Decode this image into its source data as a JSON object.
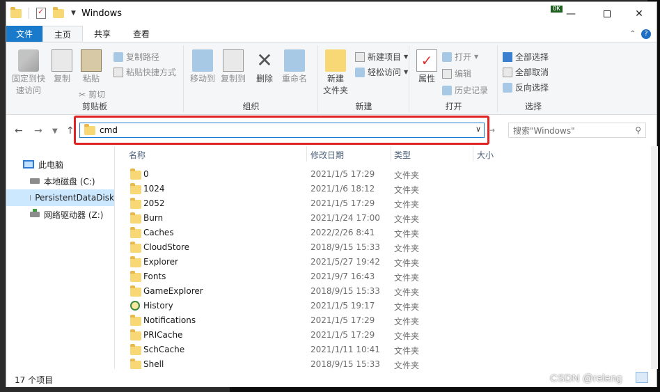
{
  "window": {
    "title": "Windows",
    "ok_badge": "OK"
  },
  "tabs": [
    {
      "label": "文件"
    },
    {
      "label": "主页"
    },
    {
      "label": "共享"
    },
    {
      "label": "查看"
    }
  ],
  "ribbon": {
    "clipboard": {
      "label": "剪贴板",
      "pin": "固定到快\n速访问",
      "copy": "复制",
      "paste": "粘贴",
      "copy_path": "复制路径",
      "paste_shortcut": "粘贴快捷方式",
      "cut": "剪切"
    },
    "organize": {
      "label": "组织",
      "move_to": "移动到",
      "copy_to": "复制到",
      "delete": "删除",
      "rename": "重命名"
    },
    "new": {
      "label": "新建",
      "new_folder": "新建\n文件夹",
      "new_item": "新建项目",
      "easy_access": "轻松访问"
    },
    "open": {
      "label": "打开",
      "properties": "属性",
      "open": "打开",
      "edit": "编辑",
      "history": "历史记录"
    },
    "select": {
      "label": "选择",
      "select_all": "全部选择",
      "select_none": "全部取消",
      "invert": "反向选择"
    }
  },
  "address": {
    "value": "cmd",
    "search_placeholder": "搜索\"Windows\""
  },
  "nav": [
    {
      "label": "此电脑"
    },
    {
      "label": "本地磁盘 (C:)"
    },
    {
      "label": "PersistentDataDisk"
    },
    {
      "label": "网络驱动器 (Z:)"
    }
  ],
  "columns": {
    "name": "名称",
    "date": "修改日期",
    "type": "类型",
    "size": "大小"
  },
  "files": [
    {
      "name": "0",
      "date": "2021/1/5 17:29",
      "type": "文件夹"
    },
    {
      "name": "1024",
      "date": "2021/1/6 18:12",
      "type": "文件夹"
    },
    {
      "name": "2052",
      "date": "2021/1/5 17:29",
      "type": "文件夹"
    },
    {
      "name": "Burn",
      "date": "2021/1/24 17:00",
      "type": "文件夹"
    },
    {
      "name": "Caches",
      "date": "2022/2/26 8:41",
      "type": "文件夹"
    },
    {
      "name": "CloudStore",
      "date": "2018/9/15 15:33",
      "type": "文件夹"
    },
    {
      "name": "Explorer",
      "date": "2021/5/27 19:42",
      "type": "文件夹"
    },
    {
      "name": "Fonts",
      "date": "2021/9/7 16:43",
      "type": "文件夹"
    },
    {
      "name": "GameExplorer",
      "date": "2018/9/15 15:33",
      "type": "文件夹"
    },
    {
      "name": "History",
      "date": "2021/1/5 19:17",
      "type": "文件夹"
    },
    {
      "name": "Notifications",
      "date": "2021/1/5 17:29",
      "type": "文件夹"
    },
    {
      "name": "PRICache",
      "date": "2021/1/5 17:29",
      "type": "文件夹"
    },
    {
      "name": "SchCache",
      "date": "2021/1/11 10:41",
      "type": "文件夹"
    },
    {
      "name": "Shell",
      "date": "2018/9/15 15:33",
      "type": "文件夹"
    }
  ],
  "status": {
    "count": "17 个项目"
  },
  "watermark": "CSDN @releng",
  "colors": {
    "accent": "#1979ca",
    "highlight": "#e02323"
  }
}
